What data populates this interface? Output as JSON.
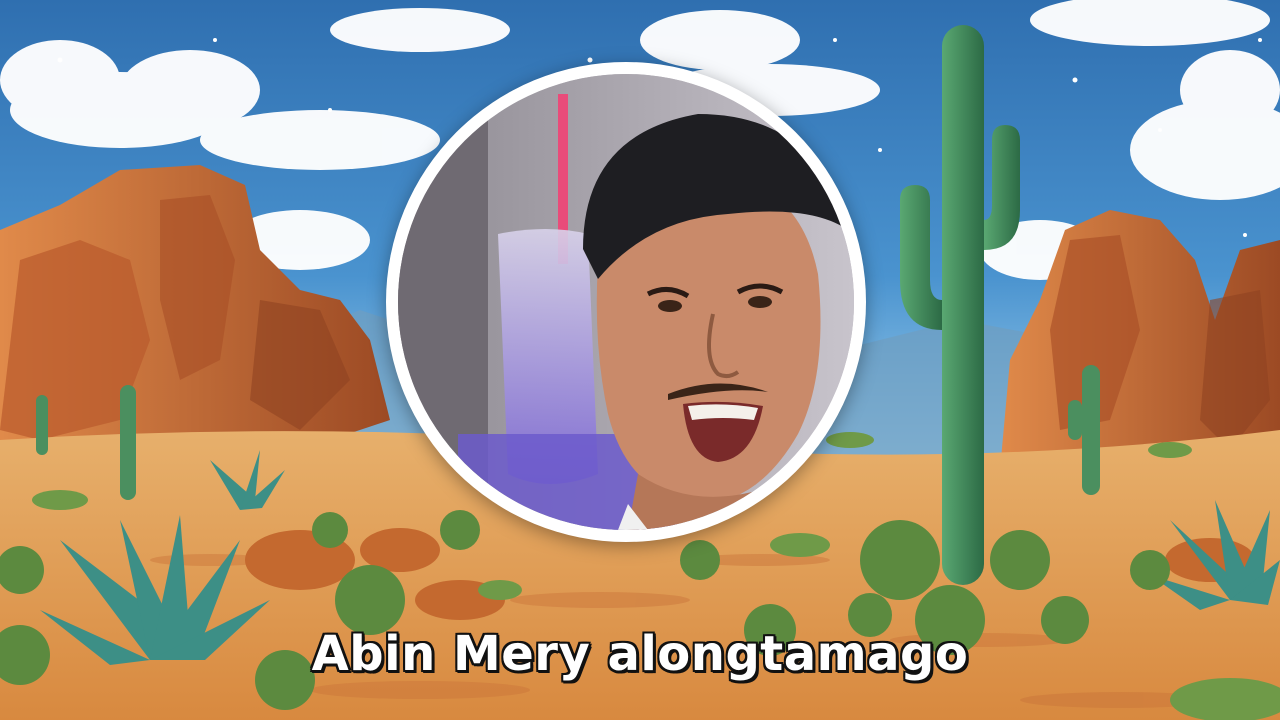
{
  "scene": {
    "background": "desert-landscape-illustration",
    "colors": {
      "sky": "#3f86c4",
      "sky_light": "#8cc3e8",
      "cloud": "#ffffff",
      "rock": "#c9723a",
      "rock_shadow": "#8f4322",
      "sand": "#e0a05a",
      "cactus": "#3f8a5a",
      "agave": "#3d8f86"
    }
  },
  "avatar": {
    "icon": "person-photo",
    "frame_color": "#ffffff"
  },
  "caption": {
    "text": "Abin Mery alongtamago"
  }
}
